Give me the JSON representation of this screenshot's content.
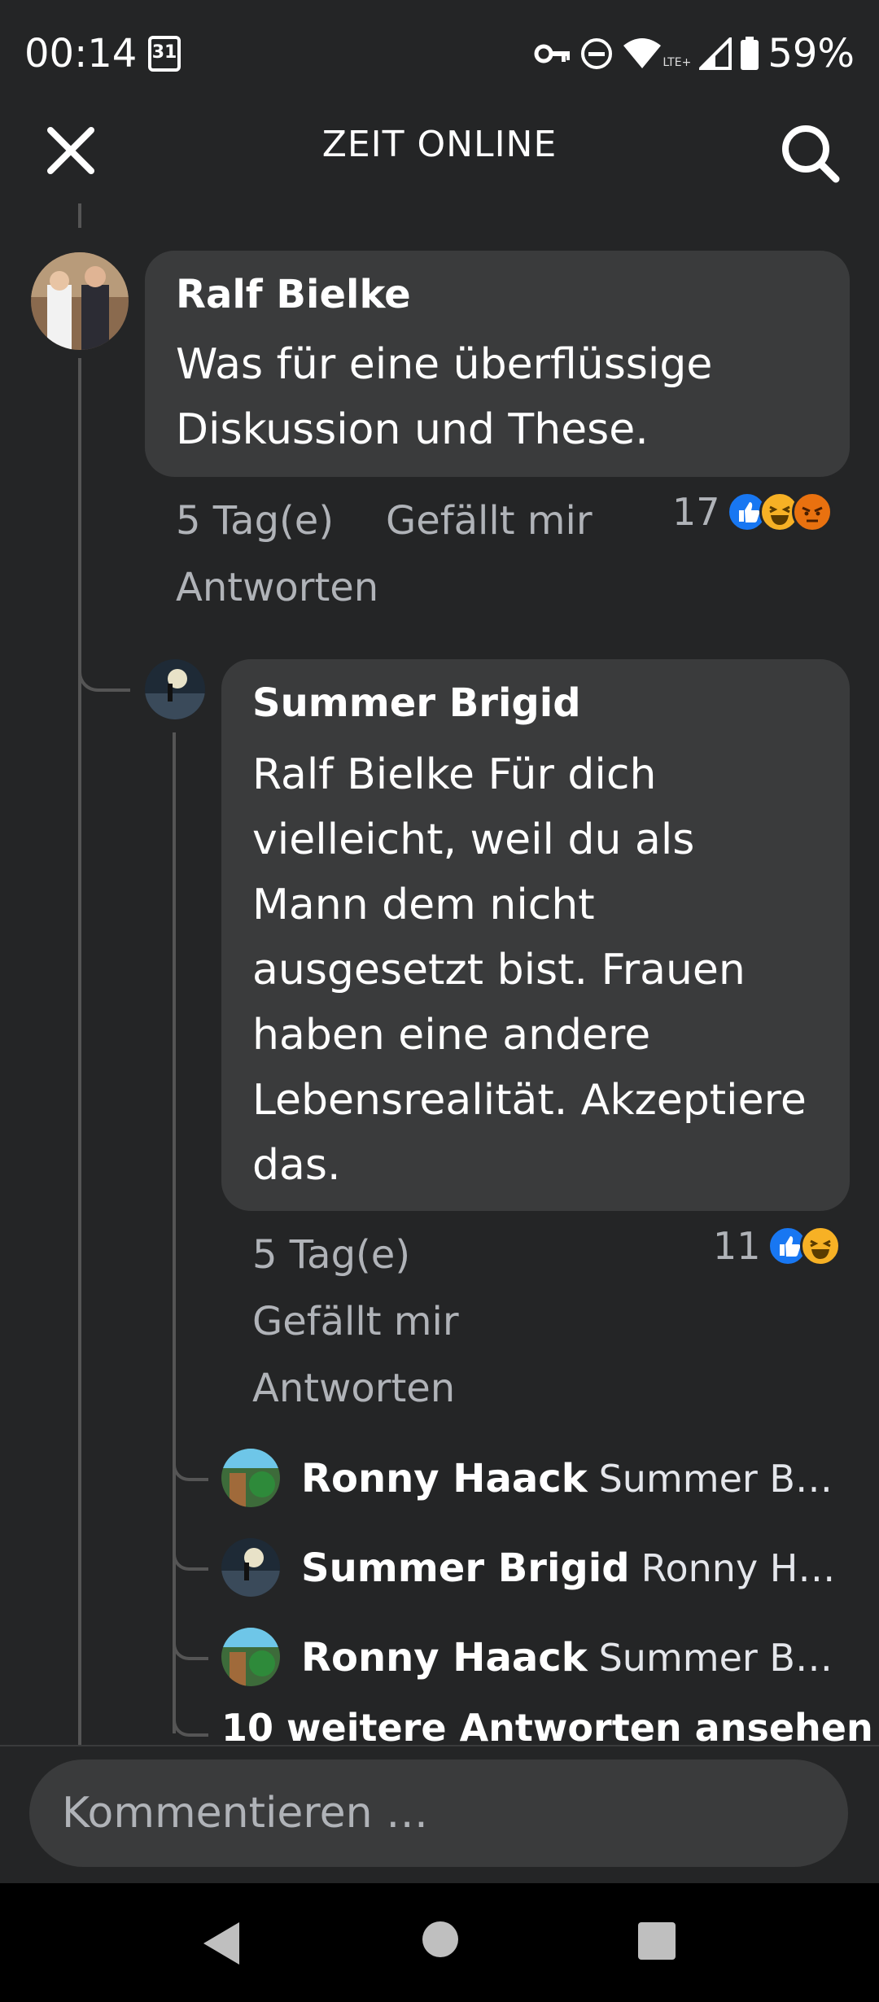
{
  "status_bar": {
    "time": "00:14",
    "calendar_day": "31",
    "battery": "59%",
    "network": "LTE+"
  },
  "header": {
    "title": "ZEIT ONLINE",
    "close_icon": "close-icon",
    "search_icon": "search-icon"
  },
  "comments": [
    {
      "author": "Ralf Bielke",
      "text_lines": [
        "Was für eine überflüssige",
        "Diskussion und These."
      ],
      "time": "5 Tag(e)",
      "like_label": "Gefällt mir",
      "reply_label": "Antworten",
      "reaction_count": "17",
      "reactions": [
        "like",
        "haha",
        "angry"
      ]
    },
    {
      "author": "Summer Brigid",
      "text_lines": [
        "Ralf Bielke Für dich",
        "vielleicht, weil du als",
        "Mann dem nicht",
        "ausgesetzt bist. Frauen",
        "haben eine andere",
        "Lebensrealität. Akzeptiere",
        "das."
      ],
      "time": "5 Tag(e)",
      "like_label": "Gefällt mir",
      "reply_label": "Antworten",
      "reaction_count": "11",
      "reactions": [
        "like",
        "haha"
      ]
    }
  ],
  "replies": [
    {
      "author": "Ronny Haack",
      "snippet": "Summer Brig…"
    },
    {
      "author": "Summer Brigid",
      "snippet": "Ronny Haa…"
    },
    {
      "author": "Ronny Haack",
      "snippet": "Summer Brig…"
    }
  ],
  "more_replies": "10 weitere Antworten ansehen",
  "composer": {
    "placeholder": "Kommentieren …"
  },
  "colors": {
    "background": "#242526",
    "bubble": "#3a3b3c",
    "like": "#1877f2",
    "haha": "#f7b125",
    "angry": "#e9710f"
  }
}
